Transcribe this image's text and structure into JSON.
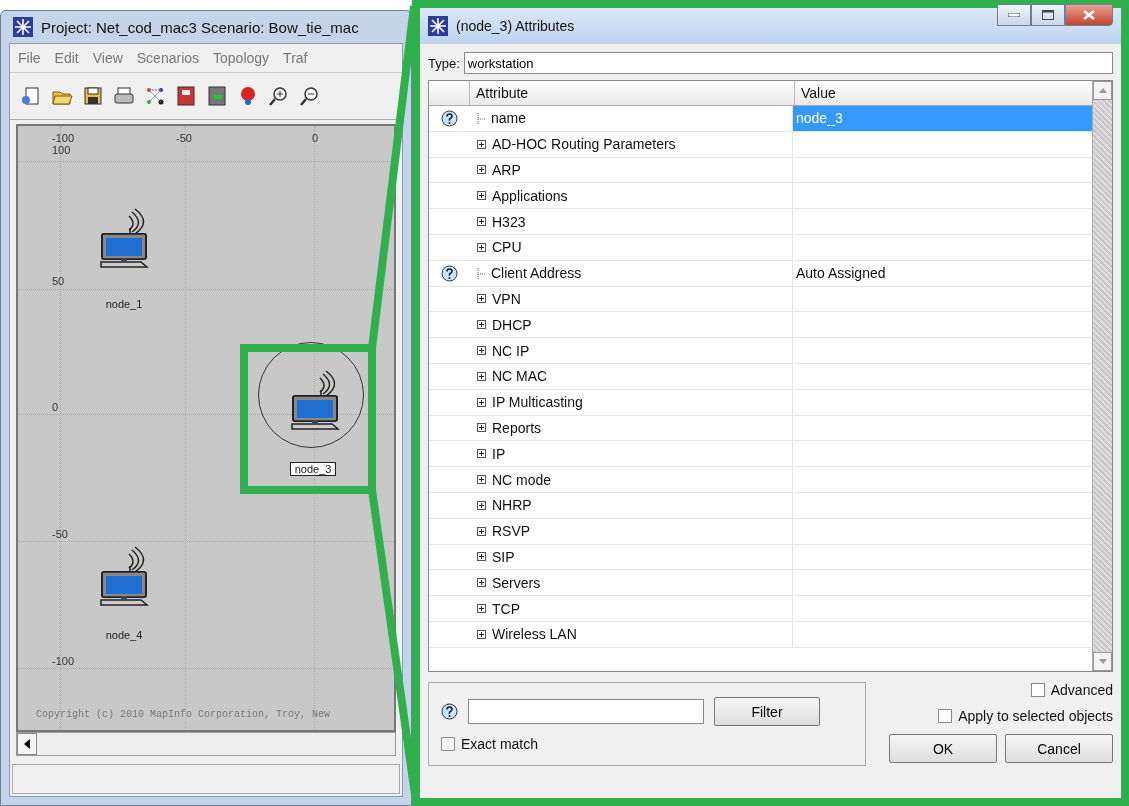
{
  "main_window": {
    "title": "Project: Net_cod_mac3 Scenario: Bow_tie_mac",
    "menu": [
      "File",
      "Edit",
      "View",
      "Scenarios",
      "Topology",
      "Traf"
    ],
    "canvas": {
      "x_labels": [
        "-100",
        "-50",
        "0"
      ],
      "y_labels": [
        "100",
        "50",
        "0",
        "-50",
        "-100"
      ],
      "nodes": [
        {
          "label": "node_1",
          "selected": false
        },
        {
          "label": "node_3",
          "selected": true
        },
        {
          "label": "node_4",
          "selected": false
        }
      ],
      "copyright": "Copyright (c) 2010 MapInfo Corporation, Troy, New"
    }
  },
  "dialog": {
    "title": "(node_3) Attributes",
    "type_label": "Type:",
    "type_value": "workstation",
    "columns": [
      "Attribute",
      "Value"
    ],
    "rows": [
      {
        "kind": "leaf",
        "attribute": "name",
        "value": "node_3",
        "selected": true
      },
      {
        "kind": "group",
        "attribute": "AD-HOC Routing Parameters",
        "selected": false
      },
      {
        "kind": "group",
        "attribute": "ARP",
        "selected": false
      },
      {
        "kind": "group",
        "attribute": "Applications",
        "selected": false
      },
      {
        "kind": "group",
        "attribute": "H323",
        "selected": false
      },
      {
        "kind": "group",
        "attribute": "CPU",
        "selected": false
      },
      {
        "kind": "leaf",
        "attribute": "Client Address",
        "value": "Auto Assigned",
        "selected": false
      },
      {
        "kind": "group",
        "attribute": "VPN",
        "selected": false
      },
      {
        "kind": "group",
        "attribute": "DHCP",
        "selected": false
      },
      {
        "kind": "group",
        "attribute": "NC IP",
        "selected": false
      },
      {
        "kind": "group",
        "attribute": "NC MAC",
        "selected": false
      },
      {
        "kind": "group",
        "attribute": "IP Multicasting",
        "selected": false
      },
      {
        "kind": "group",
        "attribute": "Reports",
        "selected": false
      },
      {
        "kind": "group",
        "attribute": "IP",
        "selected": false
      },
      {
        "kind": "group",
        "attribute": "NC mode",
        "selected": false
      },
      {
        "kind": "group",
        "attribute": "NHRP",
        "selected": false
      },
      {
        "kind": "group",
        "attribute": "RSVP",
        "selected": false
      },
      {
        "kind": "group",
        "attribute": "SIP",
        "selected": false
      },
      {
        "kind": "group",
        "attribute": "Servers",
        "selected": false
      },
      {
        "kind": "group",
        "attribute": "TCP",
        "selected": false
      },
      {
        "kind": "group",
        "attribute": "Wireless LAN",
        "selected": false
      }
    ],
    "filter_button": "Filter",
    "exact_match": {
      "label": "Exact match",
      "checked": false
    },
    "advanced": {
      "label": "Advanced",
      "checked": false
    },
    "apply_selected": {
      "label": "Apply to selected objects",
      "checked": false
    },
    "ok_button": "OK",
    "cancel_button": "Cancel"
  }
}
